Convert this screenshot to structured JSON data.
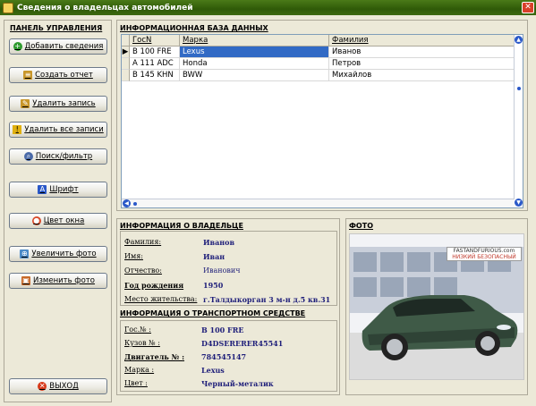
{
  "window": {
    "title": "Сведения о владельцах автомобилей",
    "close_icon": "close-icon"
  },
  "left_panel": {
    "caption": "ПАНЕЛЬ УПРАВЛЕНИЯ",
    "buttons": [
      {
        "label": "Добавить сведения",
        "icon": "add-icon",
        "icon_color": "#2e9a2e"
      },
      {
        "label": "Создать отчет",
        "icon": "report-icon",
        "icon_color": "#c8962a"
      },
      {
        "label": "Удалить запись",
        "icon": "delete-icon",
        "icon_color": "#c8962a"
      },
      {
        "label": "Удалить все записи",
        "icon": "warning-icon",
        "icon_color": "#e0b010"
      },
      {
        "label": "Поиск/фильтр",
        "icon": "search-icon",
        "icon_color": "#4a6aa8"
      },
      {
        "label": "Шрифт",
        "icon": "font-icon",
        "icon_color": "#2a58c8"
      },
      {
        "label": "Цвет окна",
        "icon": "palette-icon",
        "icon_color": "#d84a2a"
      },
      {
        "label": "Увеличить фото",
        "icon": "zoom-photo-icon",
        "icon_color": "#4a8ac8"
      },
      {
        "label": "Изменить фото",
        "icon": "photo-icon",
        "icon_color": "#c86a2a"
      }
    ],
    "exit_button": {
      "label": "ВЫХОД",
      "icon": "exit-icon",
      "icon_color": "#d83a1a"
    }
  },
  "database": {
    "caption": "ИНФОРМАЦИОННАЯ БАЗА ДАННЫХ",
    "columns": [
      "ГосN",
      "Марка",
      "Фамилия"
    ],
    "rows": [
      {
        "gos": "В 100 FRE",
        "marka": "Lexus",
        "familiya": "Иванов",
        "current": true
      },
      {
        "gos": "А 111 ADC",
        "marka": "Honda",
        "familiya": "Петров",
        "current": false
      },
      {
        "gos": "В 145 KHN",
        "marka": "BWW",
        "familiya": "Михайлов",
        "current": false
      }
    ],
    "current_row_marker": "▶"
  },
  "owner": {
    "caption": "ИНФОРМАЦИЯ О ВЛАДЕЛЬЦЕ",
    "fields": [
      {
        "label": "Фамилия:",
        "value": "Иванов"
      },
      {
        "label": "Имя:",
        "value": "Иван"
      },
      {
        "label": "Отчество:",
        "value": "Иванович"
      },
      {
        "label": "Год рождения",
        "value": "1950"
      },
      {
        "label": "Место жительства:",
        "value": "г.Талдыкорган 3 м-н д.5 кв.31"
      }
    ]
  },
  "vehicle": {
    "caption": "ИНФОРМАЦИЯ О ТРАНСПОРТНОМ СРЕДСТВЕ",
    "fields": [
      {
        "label": "Гос.№ :",
        "value": "В 100 FRE"
      },
      {
        "label": "Кузов № :",
        "value": "D4DSERERER45541"
      },
      {
        "label": "Двигатель № :",
        "value": "784545147"
      },
      {
        "label": "Марка :",
        "value": "Lexus"
      },
      {
        "label": "Цвет :",
        "value": "Черный-металик"
      }
    ]
  },
  "photo": {
    "caption": "ФОТО",
    "watermark_line1": "FASTANDFURIOUS.com",
    "watermark_line2": "НИЗКИЙ БЕЗОПАСНЫЙ"
  }
}
